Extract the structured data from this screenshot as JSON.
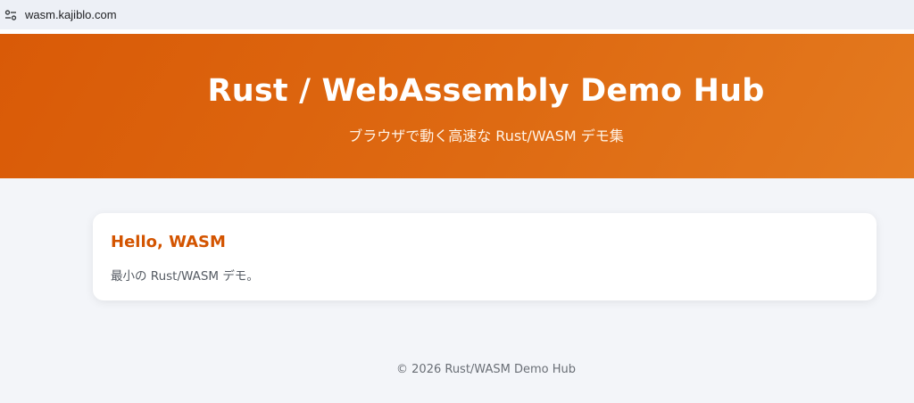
{
  "browser": {
    "url": "wasm.kajiblo.com",
    "site_info_icon": "tune-icon"
  },
  "hero": {
    "title": "Rust / WebAssembly Demo Hub",
    "subtitle": "ブラウザで動く高速な Rust/WASM デモ集"
  },
  "demos": [
    {
      "title": "Hello, WASM",
      "description": "最小の Rust/WASM デモ。"
    }
  ],
  "footer": {
    "text": "© 2026 Rust/WASM Demo Hub"
  },
  "colors": {
    "accent": "#d35400",
    "hero_gradient_start": "#d95a07",
    "hero_gradient_end": "#e47a1f",
    "page_background": "#f3f5f9"
  }
}
